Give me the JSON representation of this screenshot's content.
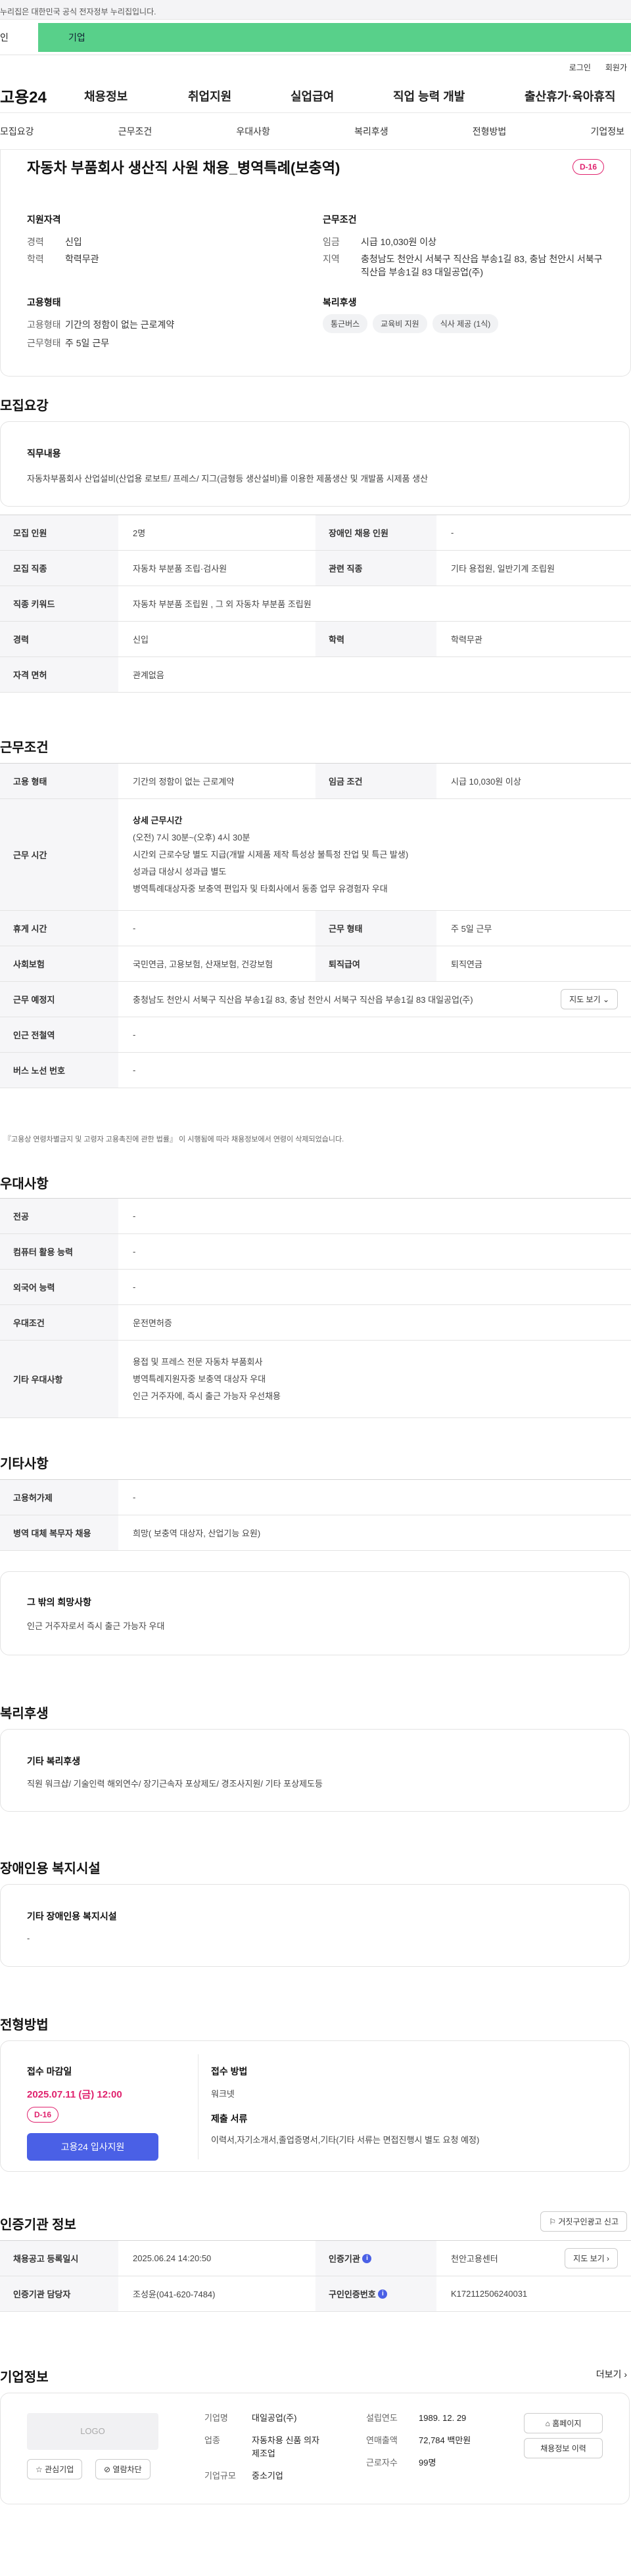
{
  "gov_notice": "누리집은 대한민국 공식 전자정부 누리집입니다.",
  "user_tabs": {
    "personal": "인",
    "company": "기업"
  },
  "util_links": [
    "로그인",
    "회원가"
  ],
  "site_logo": "고용24",
  "gnb": [
    "채용정보",
    "취업지원",
    "실업급여",
    "직업 능력 개발",
    "출산휴가·육아휴직"
  ],
  "anchors": [
    "모집요강",
    "근무조건",
    "우대사항",
    "복리후생",
    "전형방법",
    "기업정보"
  ],
  "summary": {
    "title": "자동차 부품회사 생산직 사원 채용_병역특례(보충역)",
    "dday": "D-16",
    "qual_title": "지원자격",
    "career_k": "경력",
    "career_v": "신입",
    "edu_k": "학력",
    "edu_v": "학력무관",
    "cond_title": "근무조건",
    "wage_k": "임금",
    "wage_v": "시급 10,030원 이상",
    "region_k": "지역",
    "region_v": "충청남도 천안시 서북구 직산읍 부송1길 83, 충남 천안시 서북구 직산읍 부송1길 83 대일공업(주)",
    "emp_title": "고용형태",
    "emp_k": "고용형태",
    "emp_v": "기간의 정함이 없는 근로계약",
    "work_k": "근무형태",
    "work_v": "주 5일 근무",
    "welfare_title": "복리후생",
    "welfare_tags": [
      "통근버스",
      "교육비 지원",
      "식사 제공 (1식)"
    ]
  },
  "recruit": {
    "section_title": "모집요강",
    "job_title": "직무내용",
    "job_desc": "자동차부품회사 산업설비(산업용 로보트/ 프레스/ 지그(금형등 생산설비)를 이용한 제품생산 및 개발품 시제품 생산",
    "count_k": "모집 인원",
    "count_v": "2명",
    "disabled_k": "장애인 채용 인원",
    "disabled_v": "-",
    "job_k": "모집 직종",
    "job_v": "자동차 부분품 조립·검사원",
    "rel_k": "관련 직종",
    "rel_v": "기타 용접원, 일반기계 조립원",
    "kw_k": "직종 키워드",
    "kw_v": "자동차 부분품 조립원 , 그 외 자동차 부분품 조립원",
    "career_k": "경력",
    "career_v": "신입",
    "edu_k": "학력",
    "edu_v": "학력무관",
    "license_k": "자격 면허",
    "license_v": "관계없음"
  },
  "conditions": {
    "section_title": "근무조건",
    "emp_k": "고용 형태",
    "emp_v": "기간의 정함이 없는 근로계약",
    "wage_k": "임금 조건",
    "wage_v": "시급 10,030원 이상",
    "hours_k": "근무 시간",
    "hours_title": "상세 근무시간",
    "hours_lines": [
      "(오전) 7시 30분~(오후) 4시 30분",
      "시간외 근로수당 별도 지급(개발 시제품 제작 특성상 불특정 잔업 및 특근 발생)",
      "성과급 대상시 성과급 별도",
      "병역특례대상자중 보충역 편입자 및 타회사에서 동종 업무 유경험자 우대"
    ],
    "rest_k": "휴게 시간",
    "rest_v": "-",
    "form_k": "근무 형태",
    "form_v": "주 5일 근무",
    "ins_k": "사회보험",
    "ins_v": "국민연금, 고용보험, 산재보험, 건강보험",
    "ret_k": "퇴직급여",
    "ret_v": "퇴직연금",
    "place_k": "근무 예정지",
    "place_v": "충청남도 천안시 서북구 직산읍 부송1길 83, 충남 천안시 서북구 직산읍 부송1길 83 대일공업(주)",
    "map_btn": "지도 보기",
    "subway_k": "인근 전철역",
    "subway_v": "-",
    "bus_k": "버스 노선 번호",
    "bus_v": "-",
    "note": "『고용상 연령차별금지 및 고령자 고용촉진에 관한 법률』 이 시행됨에 따라 채용정보에서 연령이 삭제되었습니다."
  },
  "prefer": {
    "section_title": "우대사항",
    "major_k": "전공",
    "major_v": "-",
    "pc_k": "컴퓨터 활용 능력",
    "pc_v": "-",
    "lang_k": "외국어 능력",
    "lang_v": "-",
    "cond_k": "우대조건",
    "cond_v": "운전면허증",
    "etc_k": "기타 우대사항",
    "etc_lines": [
      "용접 및 프레스 전문 자동차 부품회사",
      "병역특례지원자중 보충역 대상자 우대",
      "인근 거주자에, 즉시 출근 가능자 우선채용"
    ]
  },
  "other": {
    "section_title": "기타사항",
    "emp_k": "고용허가제",
    "emp_v": "-",
    "mil_k": "병역 대체 복무자 채용",
    "mil_v": "희망( 보충역 대상자, 산업기능 요원)",
    "hope_title": "그 밖의 희망사항",
    "hope_v": "인근 거주자로서 즉시 출근 가능자 우대"
  },
  "welfare": {
    "section_title": "복리후생",
    "box_title": "기타 복리후생",
    "box_v": "직원 워크샵/ 기술인력 해외연수/ 장기근속자 포상제도/ 경조사지원/ 기타 포상제도등"
  },
  "disabled": {
    "section_title": "장애인용 복지시설",
    "box_title": "기타 장애인용 복지시설",
    "box_v": "-"
  },
  "process": {
    "section_title": "전형방법",
    "deadline_title": "접수 마감일",
    "deadline_v": "2025.07.11 (금) 12:00",
    "dday": "D-16",
    "apply_btn": "고용24 입사지원",
    "method_title": "접수 방법",
    "method_v": "워크넷",
    "docs_title": "제출 서류",
    "docs_v": "이력서,자기소개서,졸업증명서,기타(기타 서류는 면접진행시 별도 요청 예정)"
  },
  "agency": {
    "section_title": "인증기관 정보",
    "report_btn": "거짓구인광고 신고",
    "reg_k": "채용공고 등록일시",
    "reg_v": "2025.06.24 14:20:50",
    "org_k": "인증기관",
    "org_v": "천안고용센터",
    "map_btn": "지도 보기",
    "mgr_k": "인증기관 담당자",
    "mgr_v": "조성윤(041-620-7484)",
    "no_k": "구인인증번호",
    "no_v": "K172112506240031"
  },
  "company": {
    "section_title": "기업정보",
    "more": "더보기",
    "logo_placeholder": "LOGO",
    "fav_btn": "관심기업",
    "block_btn": "열람차단",
    "name_k": "기업명",
    "name_v": "대일공업(주)",
    "industry_k": "업종",
    "industry_v": "자동차용 신품 의자 제조업",
    "size_k": "기업규모",
    "size_v": "중소기업",
    "est_k": "설립연도",
    "est_v": "1989. 12. 29",
    "sales_k": "연매출액",
    "sales_v": "72,784 백만원",
    "emp_k": "근로자수",
    "emp_v": "99명",
    "home_btn": "홈페이지",
    "history_btn": "채용정보 이력"
  }
}
